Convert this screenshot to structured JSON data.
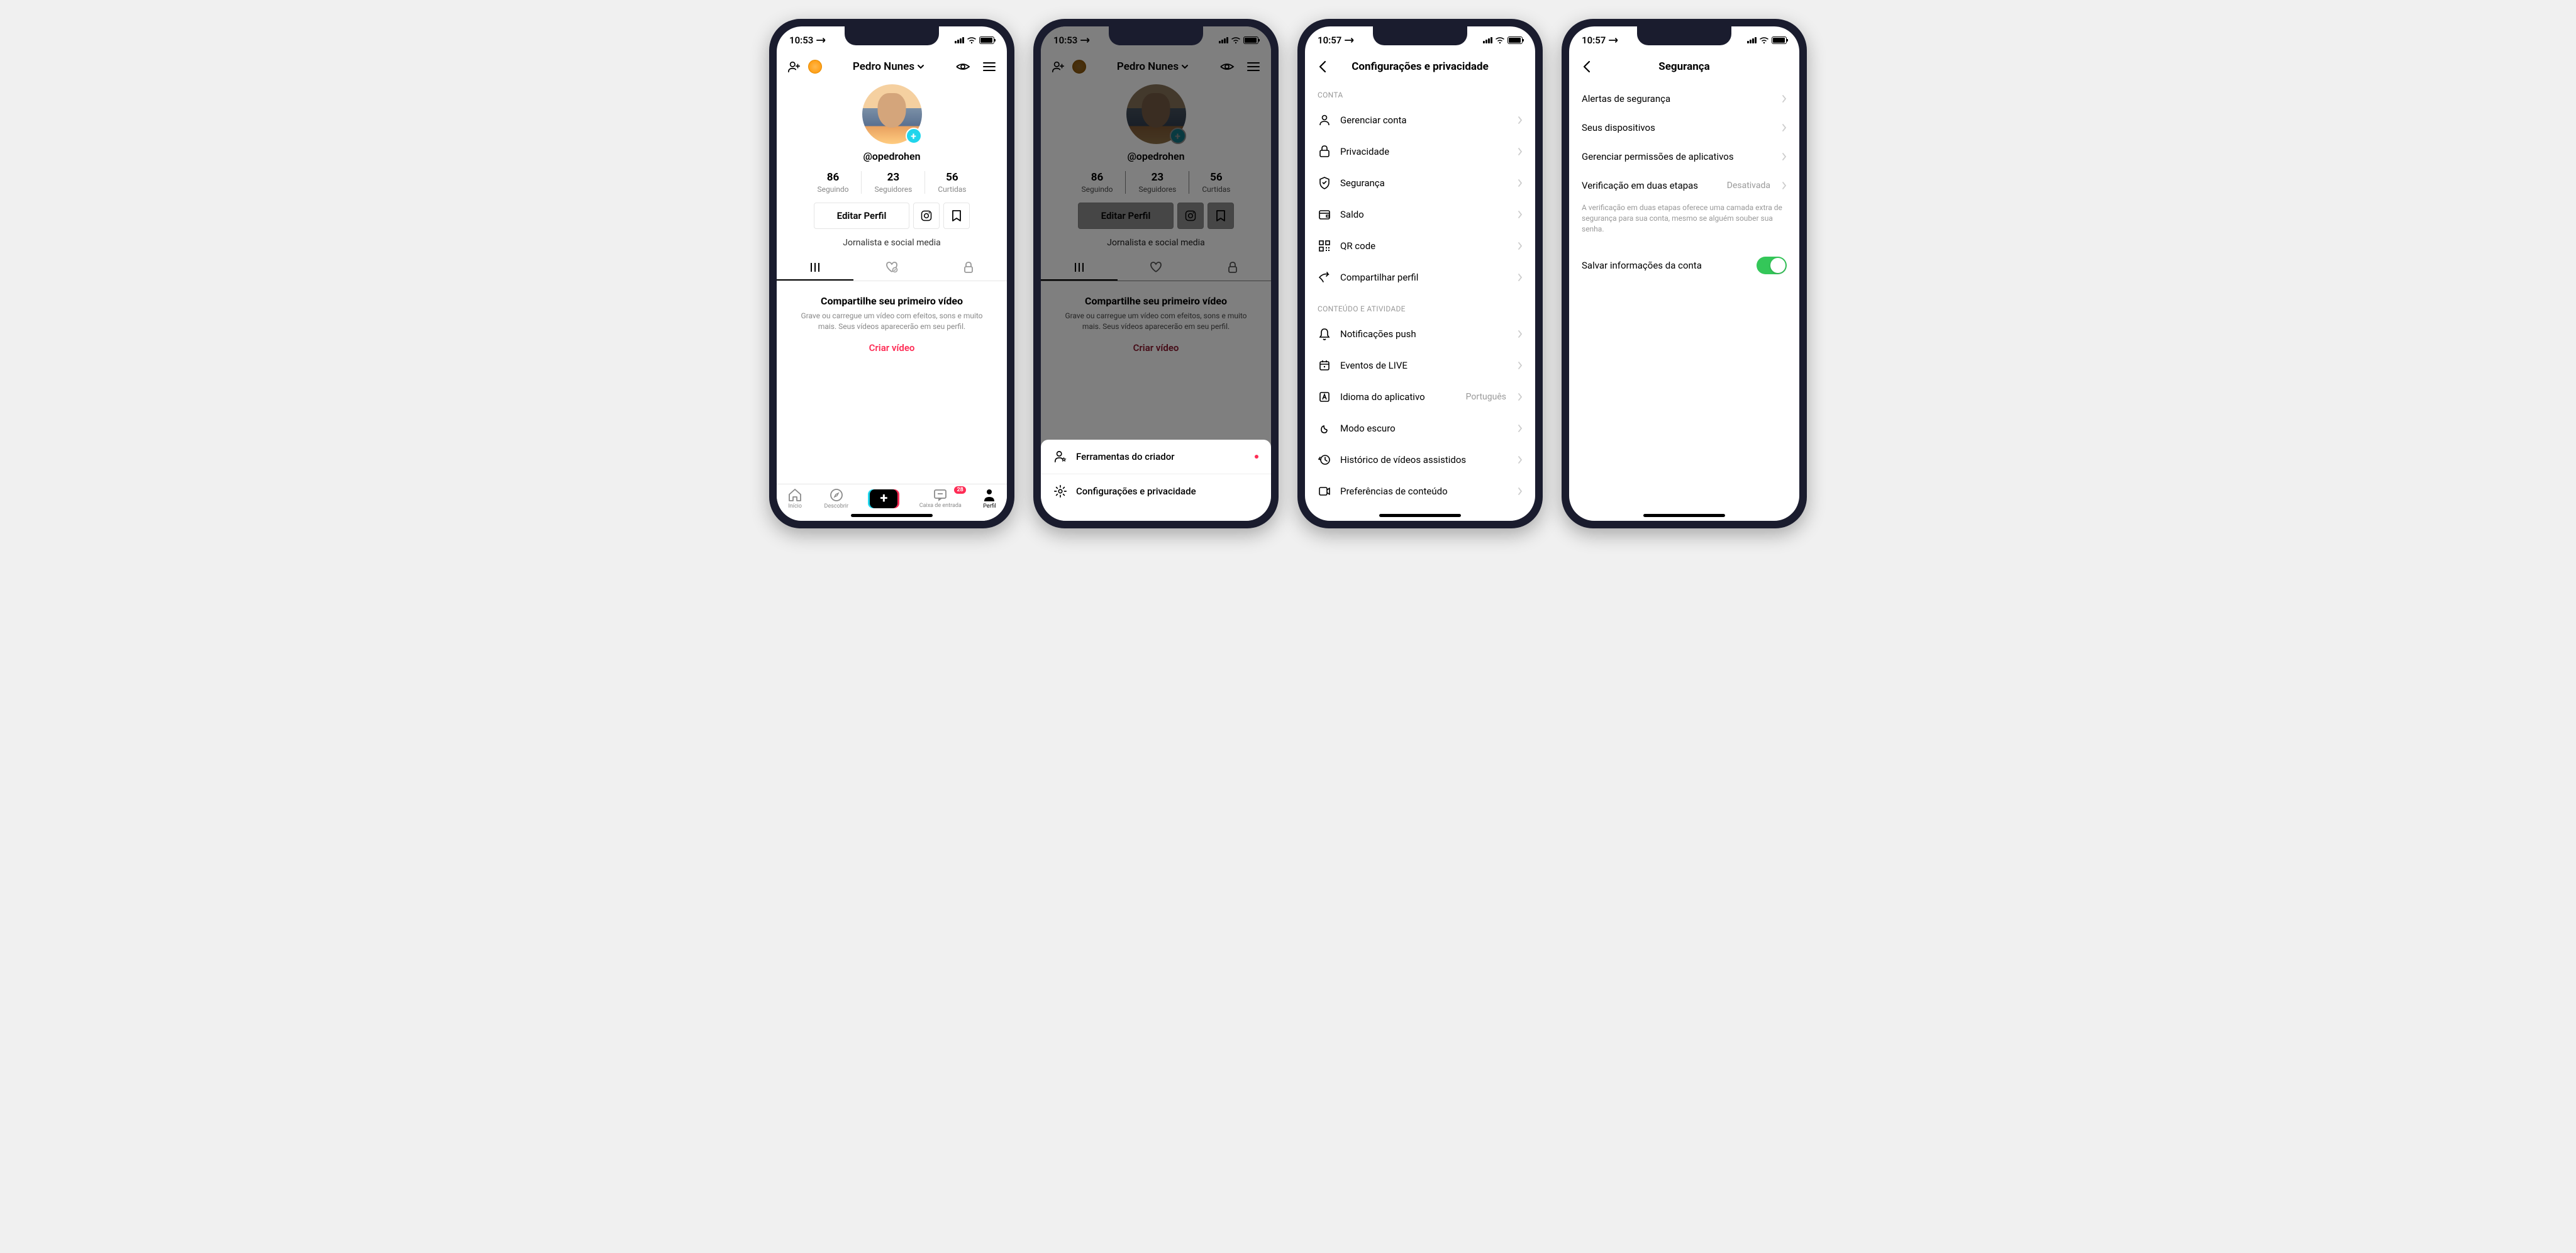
{
  "status": {
    "time1": "10:53",
    "time2": "10:57"
  },
  "profile": {
    "name": "Pedro Nunes",
    "username": "@opedrohen",
    "bio": "Jornalista e social media",
    "stats": [
      {
        "num": "86",
        "label": "Seguindo"
      },
      {
        "num": "23",
        "label": "Seguidores"
      },
      {
        "num": "56",
        "label": "Curtidas"
      }
    ],
    "edit_btn": "Editar Perfil",
    "empty_title": "Compartilhe seu primeiro vídeo",
    "empty_desc": "Grave ou carregue um vídeo com efeitos, sons e muito mais. Seus vídeos aparecerão em seu perfil.",
    "create_link": "Criar vídeo"
  },
  "bottom_nav": {
    "home": "Início",
    "discover": "Descobrir",
    "inbox": "Caixa de entrada",
    "inbox_badge": "28",
    "profile": "Perfil"
  },
  "sheet": {
    "creator_tools": "Ferramentas do criador",
    "settings": "Configurações e privacidade"
  },
  "settings_page": {
    "title": "Configurações e privacidade",
    "section_account": "CONTA",
    "section_content": "CONTEÚDO E ATIVIDADE",
    "items_account": [
      "Gerenciar conta",
      "Privacidade",
      "Segurança",
      "Saldo",
      "QR code",
      "Compartilhar perfil"
    ],
    "items_content": [
      "Notificações push",
      "Eventos de LIVE",
      "Idioma do aplicativo",
      "Modo escuro",
      "Histórico de vídeos assistidos",
      "Preferências de conteúdo"
    ],
    "lang_value": "Português"
  },
  "security_page": {
    "title": "Segurança",
    "items": [
      "Alertas de segurança",
      "Seus dispositivos",
      "Gerenciar permissões de aplicativos"
    ],
    "two_step": "Verificação em duas etapas",
    "two_step_value": "Desativada",
    "two_step_desc": "A verificação em duas etapas oferece uma camada extra de segurança para sua conta, mesmo se alguém souber sua senha.",
    "save_info": "Salvar informações da conta"
  }
}
